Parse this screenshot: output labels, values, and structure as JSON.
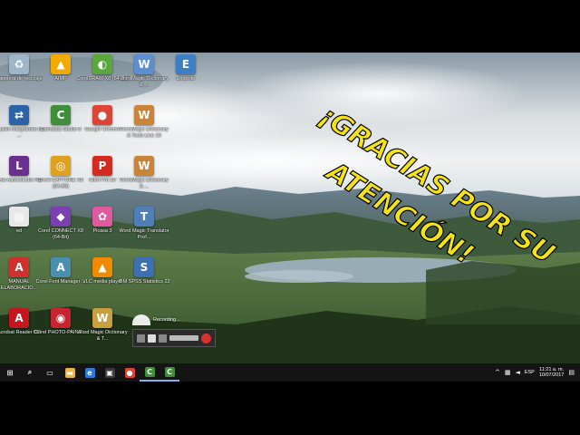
{
  "desktop": {
    "icons": [
      {
        "label": "Papelera de reciclaje",
        "icon": "recycle-bin-icon",
        "color": "#9fb6c8",
        "glyph": "♻"
      },
      {
        "label": "AIMP",
        "icon": "aimp-icon",
        "color": "#f2a900",
        "glyph": "▲"
      },
      {
        "label": "CorelDRAW X8 (64-Bit)",
        "icon": "coreldraw-icon",
        "color": "#5aa83c",
        "glyph": "◐"
      },
      {
        "label": "WordMagic Dictionary & ...",
        "icon": "wordmagic-icon",
        "color": "#5b8fd1",
        "glyph": "W"
      },
      {
        "label": "Endnote",
        "icon": "endnote-icon",
        "color": "#3c7fc4",
        "glyph": "E"
      },
      {
        "label": "¿Quién Integrantes en ...",
        "icon": "teamviewer-icon",
        "color": "#2c62a8",
        "glyph": "⇄"
      },
      {
        "label": "Camtasia Studio 8",
        "icon": "camtasia-icon",
        "color": "#3f8f3a",
        "glyph": "C"
      },
      {
        "label": "Google Chrome",
        "icon": "chrome-icon",
        "color": "#db4437",
        "glyph": "●"
      },
      {
        "label": "WordMagic Dictionary & Tools Line 10",
        "icon": "wordmagic-tools-icon",
        "color": "#c9843a",
        "glyph": "W"
      },
      {
        "label": "LAB Autoestudio HD",
        "icon": "lab-icon",
        "color": "#6b2f8f",
        "glyph": "L"
      },
      {
        "label": "Corel CAPTURE X8 (64-Bit)",
        "icon": "corel-capture-icon",
        "color": "#e0a020",
        "glyph": "◎"
      },
      {
        "label": "Nitro Pro 10",
        "icon": "nitro-icon",
        "color": "#d52b1e",
        "glyph": "P"
      },
      {
        "label": "WordMagic Dictionary & ...",
        "icon": "wordmagic-dict-icon",
        "color": "#c9843a",
        "glyph": "W"
      },
      {
        "label": "ed",
        "icon": "file-icon",
        "color": "#e8e8e8",
        "glyph": "▤"
      },
      {
        "label": "Corel CONNECT X8 (64-Bit)",
        "icon": "corel-connect-icon",
        "color": "#7a3fb0",
        "glyph": "◆"
      },
      {
        "label": "Picasa 3",
        "icon": "picasa-icon",
        "color": "#e05a9f",
        "glyph": "✿"
      },
      {
        "label": "Word Magic Translator Prof...",
        "icon": "translator-icon",
        "color": "#4f7fb8",
        "glyph": "T"
      },
      {
        "label": "MANUAL ELABORACIO...",
        "icon": "pdf-manual-icon",
        "color": "#d0312d",
        "glyph": "A"
      },
      {
        "label": "Corel Font Manager ...",
        "icon": "corel-font-icon",
        "color": "#4a8fb0",
        "glyph": "A"
      },
      {
        "label": "VLC media player",
        "icon": "vlc-icon",
        "color": "#f08a00",
        "glyph": "▲"
      },
      {
        "label": "IBM SPSS Statistics 22",
        "icon": "spss-icon",
        "color": "#3c6fb4",
        "glyph": "S"
      },
      {
        "label": "Acrobat Reader DC",
        "icon": "acrobat-icon",
        "color": "#c4161c",
        "glyph": "A"
      },
      {
        "label": "Corel PHOTO-PAINT ...",
        "icon": "photopaint-icon",
        "color": "#c8242f",
        "glyph": "◉"
      },
      {
        "label": "Word Magic Dictionary & T...",
        "icon": "wordmagic-t-icon",
        "color": "#c9a040",
        "glyph": "W"
      }
    ]
  },
  "headline": {
    "line1": "¡GRACIAS POR SU",
    "line2": "ATENCIÓN!",
    "color": "#f5e31a"
  },
  "recorder": {
    "status": "Recording..."
  },
  "taskbar": {
    "items": [
      {
        "name": "start-button",
        "icon": "windows-icon",
        "glyph": "⊞",
        "color": "#141414"
      },
      {
        "name": "search-button",
        "icon": "search-icon",
        "glyph": "⌕",
        "color": "#141414"
      },
      {
        "name": "task-view-button",
        "icon": "task-view-icon",
        "glyph": "▭",
        "color": "#141414"
      },
      {
        "name": "file-explorer-button",
        "icon": "folder-icon",
        "glyph": "▬",
        "color": "#e8b64a"
      },
      {
        "name": "edge-button",
        "icon": "edge-icon",
        "glyph": "e",
        "color": "#2f7bd6"
      },
      {
        "name": "store-button",
        "icon": "store-icon",
        "glyph": "▣",
        "color": "#3a3a3a"
      },
      {
        "name": "chrome-button",
        "icon": "chrome-icon",
        "glyph": "●",
        "color": "#db4437"
      },
      {
        "name": "camtasia-button",
        "icon": "camtasia-icon",
        "glyph": "C",
        "color": "#3f8f3a"
      },
      {
        "name": "camtasia-recorder-button",
        "icon": "camtasia-recorder-icon",
        "glyph": "C",
        "color": "#3f8f3a"
      }
    ],
    "tray": {
      "language": "ESP",
      "time": "11:21 a. m.",
      "date": "10/07/2017"
    }
  }
}
